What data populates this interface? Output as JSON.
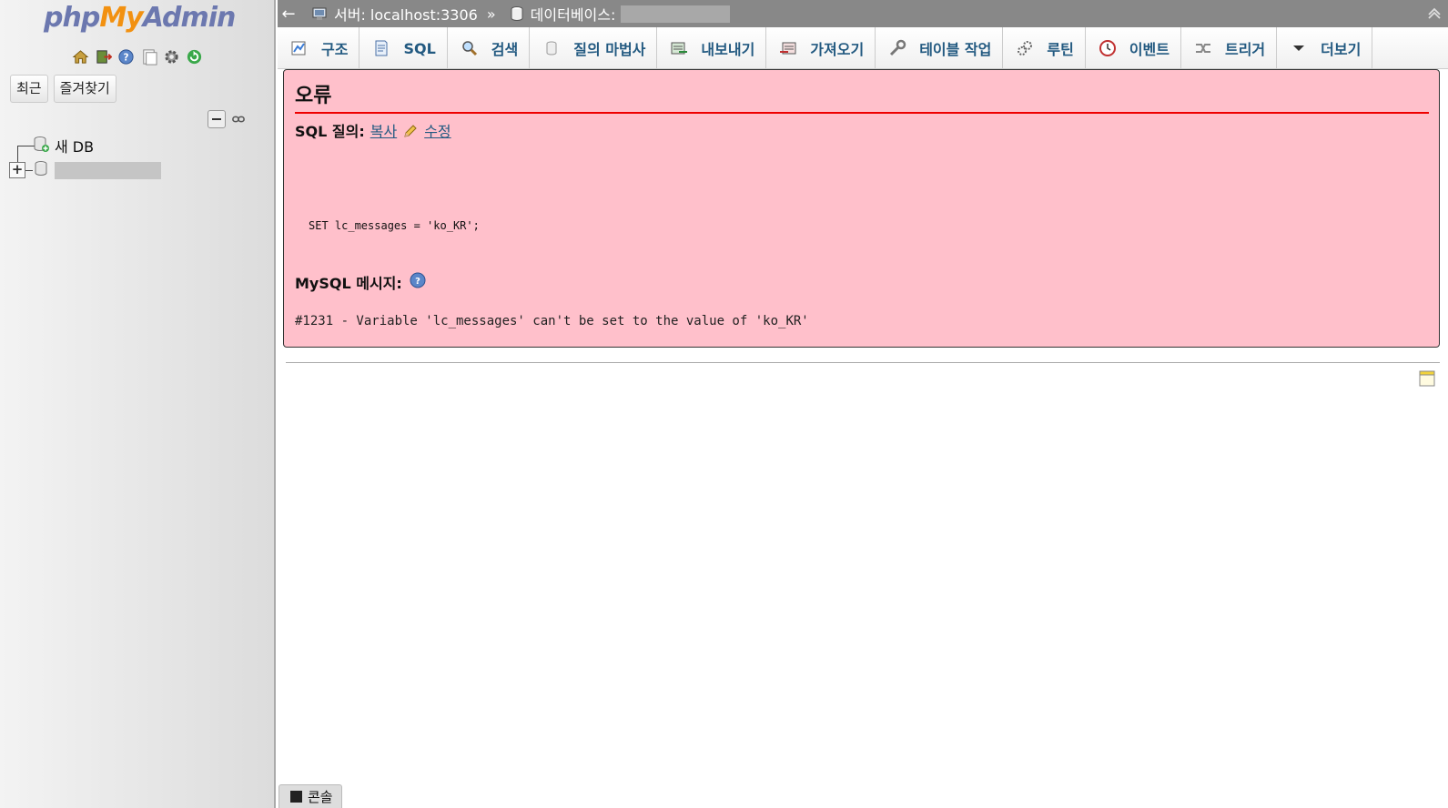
{
  "nav": {
    "logo": {
      "php": "php",
      "my": "My",
      "admin": "Admin"
    },
    "icons": [
      "home-icon",
      "logout-icon",
      "help-icon",
      "docs-icon",
      "settings-icon",
      "reload-icon"
    ],
    "tabs": {
      "recent": "최근",
      "favorites": "즐겨찾기"
    },
    "tree": {
      "new_db": "새 DB"
    }
  },
  "breadcrumb": {
    "back": "←",
    "server": "서버: localhost:3306",
    "separator": "»",
    "database": "데이터베이스:"
  },
  "menu": {
    "tabs": [
      {
        "label": "구조",
        "icon": "structure-icon"
      },
      {
        "label": "SQL",
        "icon": "sql-icon"
      },
      {
        "label": "검색",
        "icon": "search-icon"
      },
      {
        "label": "질의 마법사",
        "icon": "query-icon"
      },
      {
        "label": "내보내기",
        "icon": "export-icon"
      },
      {
        "label": "가져오기",
        "icon": "import-icon"
      },
      {
        "label": "테이블 작업",
        "icon": "operations-icon"
      },
      {
        "label": "루틴",
        "icon": "routines-icon"
      },
      {
        "label": "이벤트",
        "icon": "events-icon"
      },
      {
        "label": "트리거",
        "icon": "triggers-icon"
      },
      {
        "label": "더보기",
        "icon": "more-icon"
      }
    ]
  },
  "error": {
    "title": "오류",
    "sql_label": "SQL 질의:",
    "copy_link": "복사",
    "edit_link": "수정",
    "sql_code": "SET lc_messages = 'ko_KR';",
    "mysql_label": "MySQL 메시지:",
    "message": "#1231 - Variable 'lc_messages' can't be set to the value of 'ko_KR'"
  },
  "console": {
    "label": "콘솔"
  },
  "colors": {
    "error_bg": "#ffc0cb",
    "error_rule": "#e00000",
    "link": "#235a81",
    "topbar": "#888888"
  }
}
